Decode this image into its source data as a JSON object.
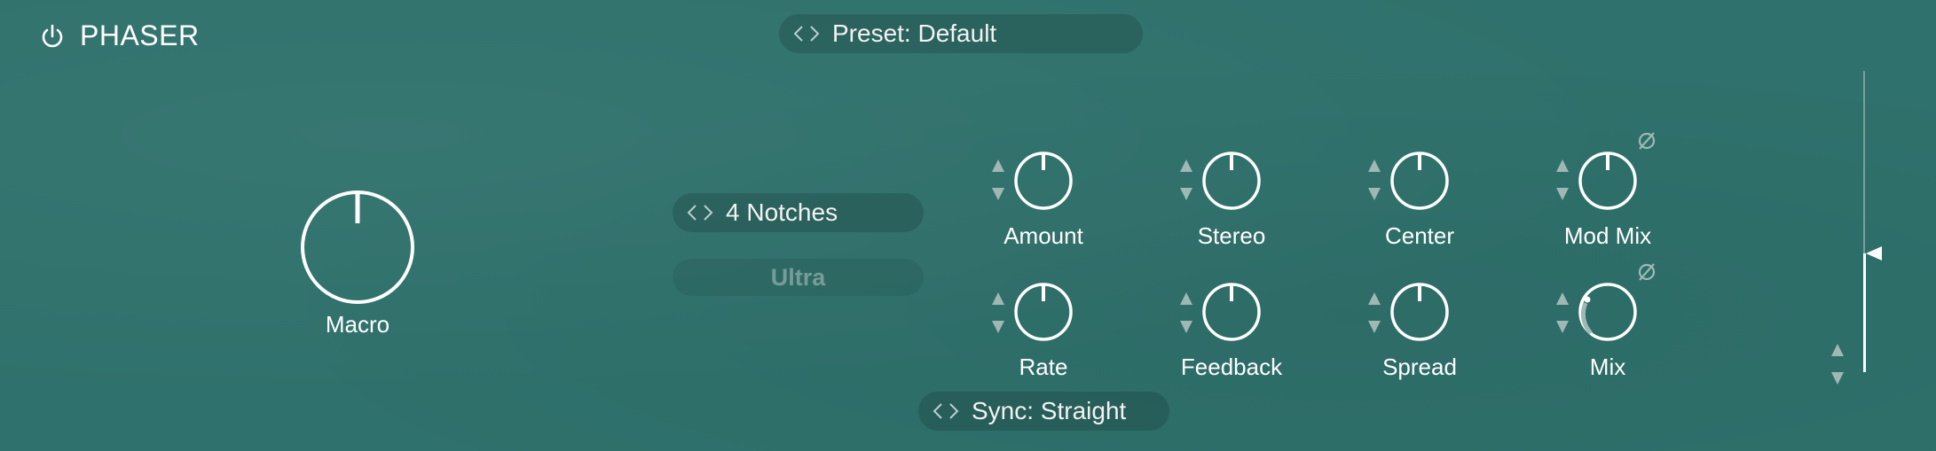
{
  "header": {
    "power_icon": "power-icon",
    "title": "PHASER",
    "preset_label": "Preset: Default"
  },
  "macro": {
    "label": "Macro",
    "value": 0.5
  },
  "mode": {
    "selector_label": "4 Notches",
    "quality_label": "Ultra"
  },
  "knobs": {
    "amount": {
      "label": "Amount",
      "value": 0.5
    },
    "stereo": {
      "label": "Stereo",
      "value": 0.5
    },
    "center": {
      "label": "Center",
      "value": 0.5
    },
    "mod_mix": {
      "label": "Mod Mix",
      "value": 0.5
    },
    "rate": {
      "label": "Rate",
      "value": 0.5
    },
    "feedback": {
      "label": "Feedback",
      "value": 0.5
    },
    "spread": {
      "label": "Spread",
      "value": 0.5
    },
    "mix": {
      "label": "Mix",
      "value": 0.15
    }
  },
  "sync": {
    "label": "Sync: Straight"
  },
  "output": {
    "level": 0.4
  },
  "colors": {
    "background": "#2f716c",
    "foreground": "#ffffff",
    "muted": "#9fb8b6"
  }
}
